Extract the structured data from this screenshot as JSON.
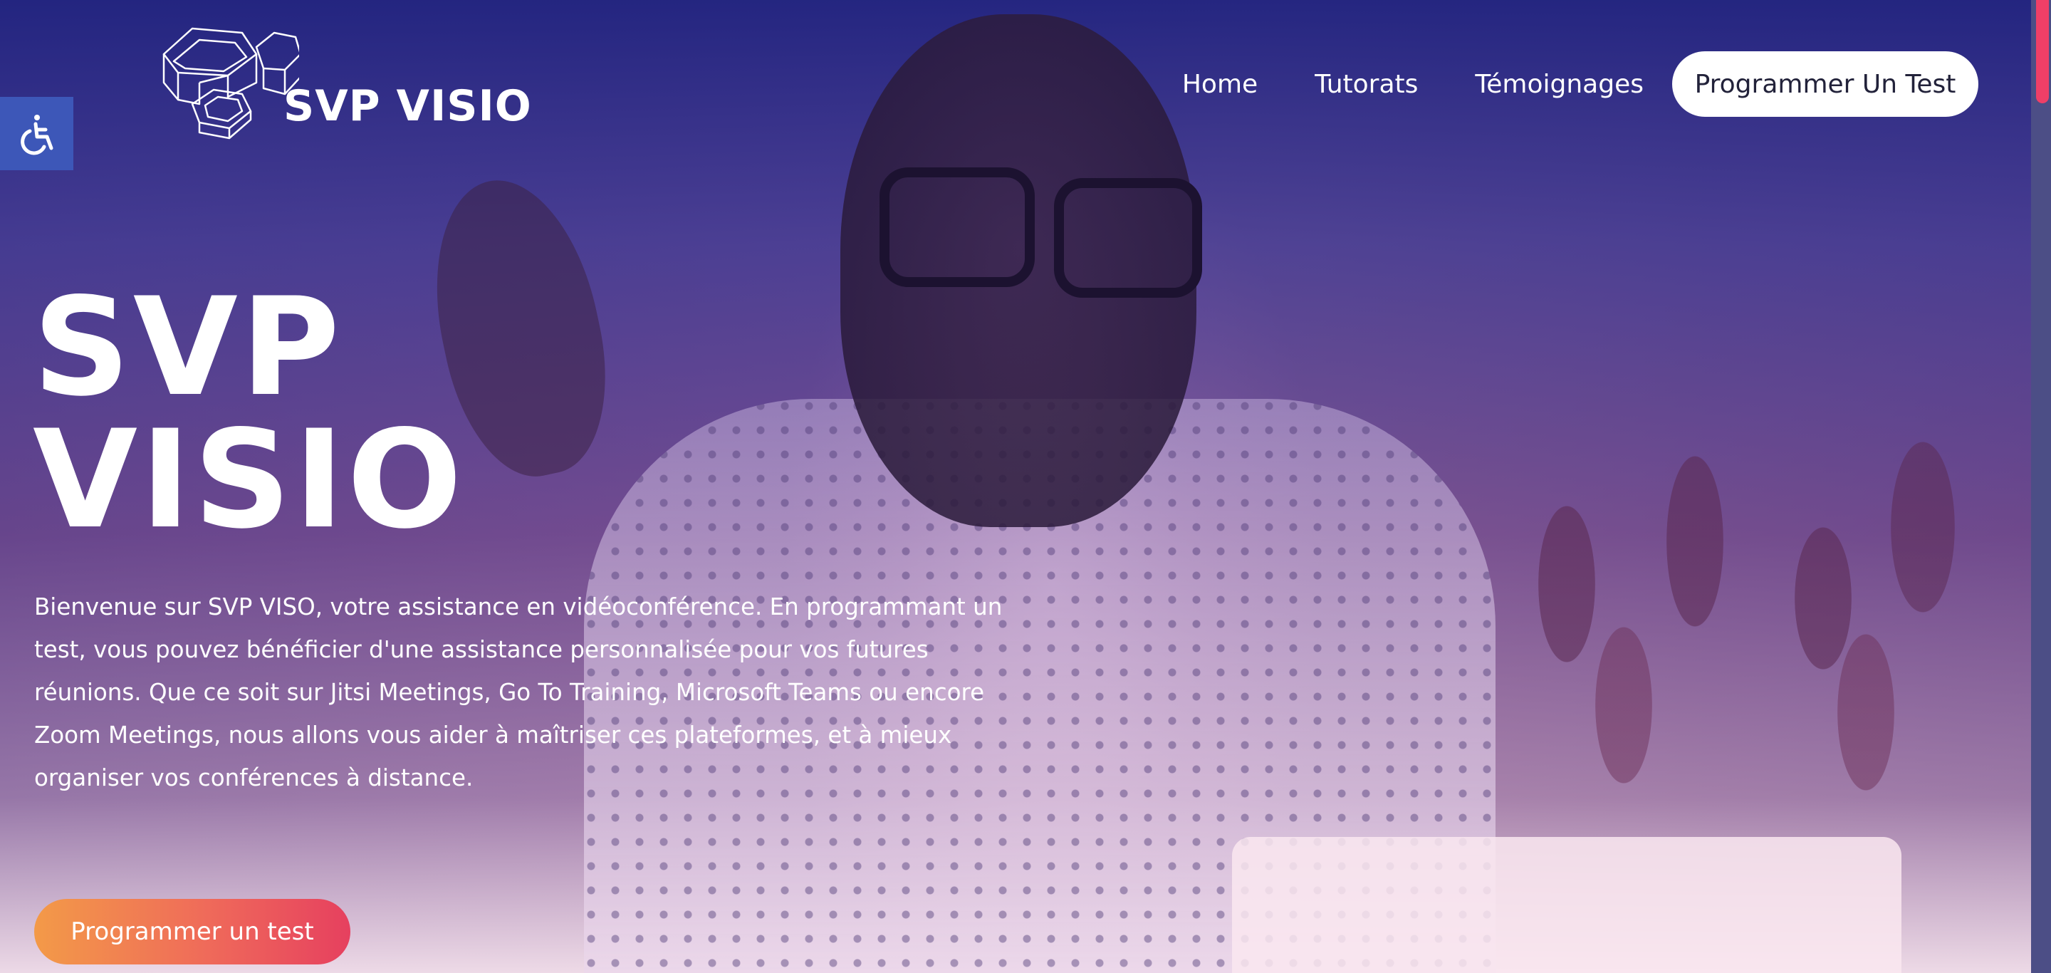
{
  "header": {
    "logo_text": "SVP VISIO",
    "nav": [
      {
        "label": "Home"
      },
      {
        "label": "Tutorats"
      },
      {
        "label": "Témoignages"
      }
    ],
    "cta_label": "Programmer Un Test"
  },
  "accessibility": {
    "icon": "wheelchair-icon"
  },
  "hero": {
    "title_line1": "SVP",
    "title_line2": "VISIO",
    "description": "Bienvenue sur SVP VISO, votre assistance en vidéoconférence. En programmant un test, vous pouvez bénéficier d'une assistance personnalisée pour vos futures réunions. Que ce soit sur Jitsi Meetings, Go To Training, Microsoft Teams ou encore Zoom Meetings, nous allons vous aider à maîtriser ces plateformes, et à mieux organiser vos conférences à distance.",
    "button_label": "Programmer un test"
  },
  "colors": {
    "accessibility_bg": "#3d57b8",
    "cta_gradient_start": "#f39a48",
    "cta_gradient_end": "#e6405f",
    "scroll_thumb": "#ef3f67"
  }
}
